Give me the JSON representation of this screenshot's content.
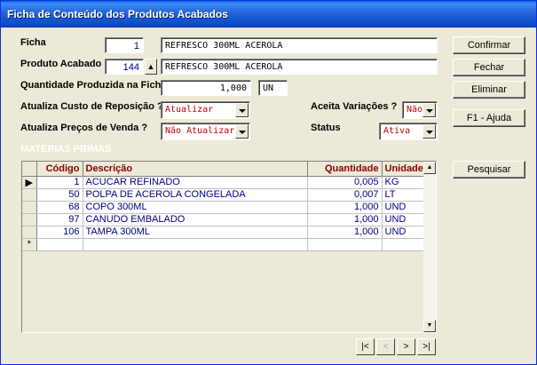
{
  "window": {
    "title": "Ficha de Conteúdo dos Produtos Acabados"
  },
  "form": {
    "ficha_label": "Ficha",
    "ficha_value": "1",
    "ficha_desc": "REFRESCO 300ML ACEROLA",
    "produto_label": "Produto Acabado",
    "produto_value": "144",
    "produto_desc": "REFRESCO 300ML ACEROLA",
    "quantidade_label": "Quantidade Produzida na Ficha",
    "quantidade_value": "1,000",
    "quantidade_unit": "UN",
    "custo_label": "Atualiza Custo de Reposição ?",
    "custo_value": "Atualizar",
    "precos_label": "Atualiza Preços de Venda ?",
    "precos_value": "Não Atualizar",
    "variacoes_label": "Aceita Variações ?",
    "variacoes_value": "Não",
    "status_label": "Status",
    "status_value": "Ativa",
    "materias_label": "MATÉRIAS PRIMAS"
  },
  "buttons": {
    "confirmar": "Confirmar",
    "fechar": "Fechar",
    "eliminar": "Eliminar",
    "ajuda": "F1 - Ajuda",
    "pesquisar": "Pesquisar"
  },
  "grid": {
    "headers": {
      "codigo": "Código",
      "descricao": "Descrição",
      "quantidade": "Quantidade",
      "unidade": "Unidade"
    },
    "rows": [
      {
        "codigo": "1",
        "descricao": "ACUCAR REFINADO",
        "quantidade": "0,005",
        "unidade": "KG"
      },
      {
        "codigo": "50",
        "descricao": "POLPA DE ACEROLA CONGELADA",
        "quantidade": "0,007",
        "unidade": "LT"
      },
      {
        "codigo": "68",
        "descricao": "COPO 300ML",
        "quantidade": "1,000",
        "unidade": "UND"
      },
      {
        "codigo": "97",
        "descricao": "CANUDO EMBALADO",
        "quantidade": "1,000",
        "unidade": "UND"
      },
      {
        "codigo": "106",
        "descricao": "TAMPA 300ML",
        "quantidade": "1,000",
        "unidade": "UND"
      }
    ],
    "new_row_marker": "*",
    "current_row_marker": "▶"
  },
  "navigator": {
    "first": "|<",
    "prev": "<",
    "next": ">",
    "last": ">|"
  },
  "icons": {
    "up_arrow": "up-arrow-icon",
    "dropdown": "chevron-down-icon"
  }
}
